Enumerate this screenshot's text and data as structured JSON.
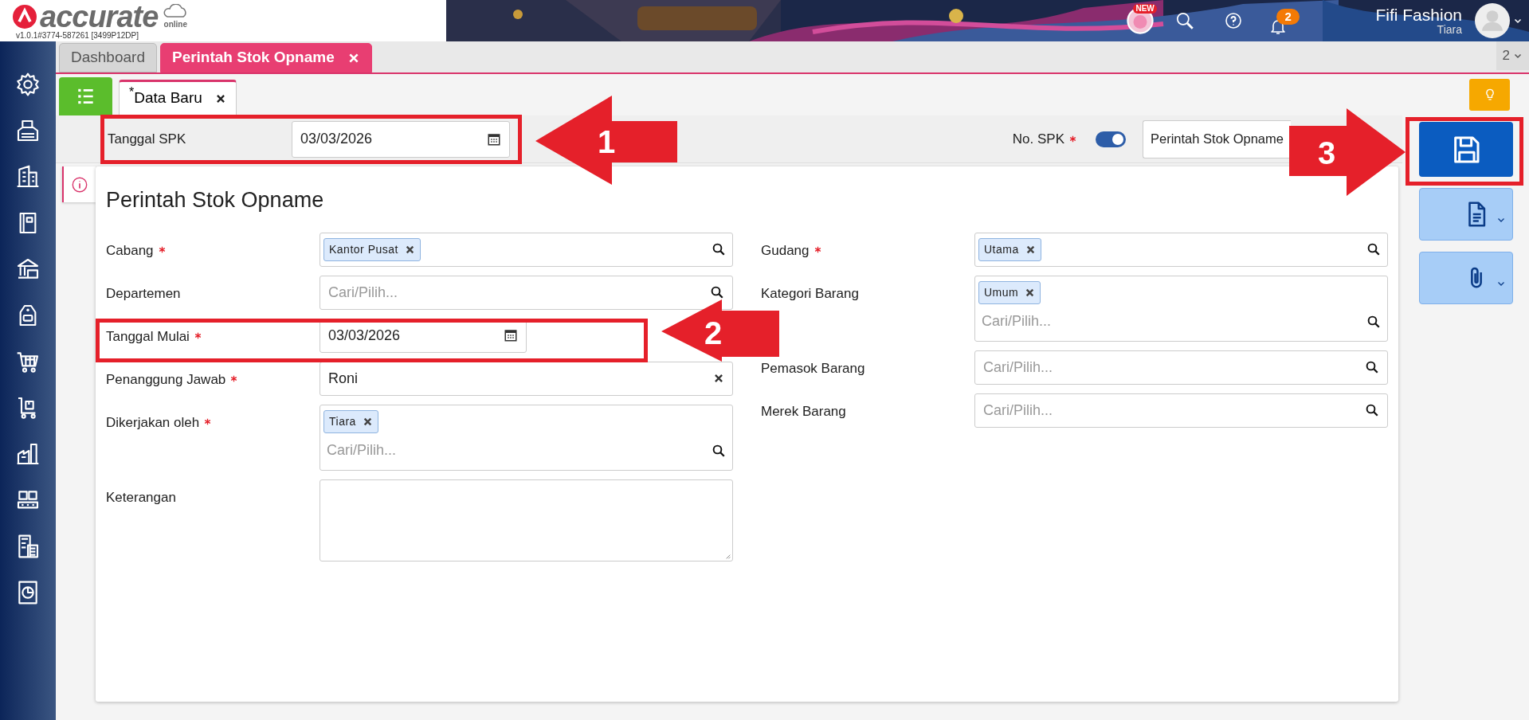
{
  "app": {
    "logo": "accurate",
    "logo_sub": "online",
    "version": "v1.0.1#3774-587261 [3499P12DP]"
  },
  "header": {
    "new_badge": "NEW",
    "notification_count": "2",
    "company": "Fifi Fashion",
    "user": "Tiara"
  },
  "tabs": [
    {
      "label": "Dashboard",
      "selected": false,
      "closable": false
    },
    {
      "label": "Perintah Stok Opname",
      "selected": true,
      "closable": true
    }
  ],
  "tab_count": "2",
  "subtabs": [
    {
      "label": "Data Baru",
      "modified_mark": "*",
      "selected": true
    }
  ],
  "header_fields": {
    "tanggal_spk": {
      "label": "Tanggal SPK",
      "value": "03/03/2026"
    },
    "no_spk": {
      "label": "No. SPK",
      "required": true,
      "auto": true,
      "value": "Perintah Stok Opname"
    }
  },
  "form": {
    "title": "Perintah Stok Opname",
    "left": [
      {
        "label": "Cabang",
        "required": true,
        "kind": "tags",
        "tags": [
          "Kantor Pusat"
        ]
      },
      {
        "label": "Departemen",
        "required": false,
        "kind": "search",
        "placeholder": "Cari/Pilih..."
      },
      {
        "label": "Tanggal Mulai",
        "required": true,
        "kind": "date",
        "value": "03/03/2026"
      },
      {
        "label": "Penanggung Jawab",
        "required": true,
        "kind": "text",
        "value": "Roni"
      },
      {
        "label": "Dikerjakan oleh",
        "required": true,
        "kind": "tags",
        "tags": [
          "Tiara"
        ],
        "placeholder": "Cari/Pilih..."
      },
      {
        "label": "Keterangan",
        "required": false,
        "kind": "textarea"
      }
    ],
    "right": [
      {
        "label": "Gudang",
        "required": true,
        "kind": "tags",
        "tags": [
          "Utama"
        ]
      },
      {
        "label": "Kategori Barang",
        "required": false,
        "kind": "tags",
        "tags": [
          "Umum"
        ],
        "placeholder": "Cari/Pilih..."
      },
      {
        "label": "Pemasok Barang",
        "required": false,
        "kind": "search",
        "placeholder": "Cari/Pilih..."
      },
      {
        "label": "Merek Barang",
        "required": false,
        "kind": "search",
        "placeholder": "Cari/Pilih..."
      }
    ]
  },
  "annotations": [
    {
      "number": "1"
    },
    {
      "number": "2"
    },
    {
      "number": "3"
    }
  ]
}
